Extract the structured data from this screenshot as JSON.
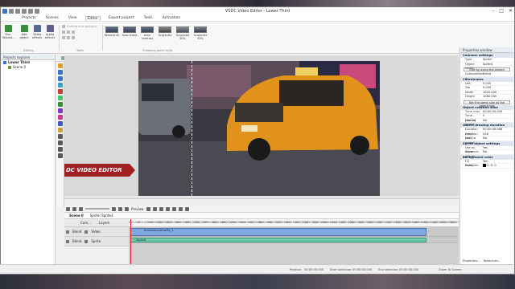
{
  "window": {
    "title": "VSDC Video Editor - Lower Third"
  },
  "menu": {
    "tabs": [
      "Projects",
      "Scenes",
      "View",
      "Editor",
      "Export project",
      "Tools",
      "Activation"
    ],
    "active": "Editor"
  },
  "ribbon": {
    "run_label": "Run Wizard...",
    "add_object_label": "Add object",
    "video_effects_label": "Video effects",
    "audio_effects_label": "Audio effects",
    "cutting_label": "Cutting and splitting",
    "editing_group": "Editing",
    "tools_group": "Tools",
    "quick_style_group": "Choosing quick style",
    "quick_styles": [
      "Remove all",
      "Auto levels",
      "Auto contrast",
      "Grayscale",
      "Grayscale 50%",
      "Grayscale 55%"
    ]
  },
  "left_panel": {
    "title": "Projects explorer",
    "items": [
      "Lower Third",
      "Scene 0"
    ],
    "bottom_tabs": [
      "Objects ex...",
      "Projects ex..."
    ]
  },
  "canvas": {
    "zoom_mode": "Zoom To Screen",
    "zoom_value": "47%",
    "lower_third_text": "DC VIDEO EDITOR"
  },
  "timeline": {
    "preview_label": "Preview",
    "tabs": [
      "Scene 0",
      "Sprite: Sprite1"
    ],
    "header_cols": [
      "Com...",
      "Layers"
    ],
    "ruler_ticks": [
      "000:000",
      "000:00.200",
      "000:00.400",
      "000:00.600",
      "000:00.800",
      "000:01.000",
      "000:01.200",
      "000:01.400",
      "000:01.600",
      "000:01.800",
      "000:02.000",
      "000:02.200",
      "000:02.400",
      "000:02.600",
      "000:02.800",
      "000:03.000",
      "000:03.200",
      "000:03.400",
      "000:03.600",
      "000:03.800",
      "000:04.000",
      "000:04.200",
      "000:04.400",
      "000:04.600",
      "000:04.800",
      "000:05.000",
      "000:05.200",
      "000:05.400",
      "000:05.600",
      "000:05.800",
      "000:06.000",
      "000:06.200",
      "000:06.400",
      "000:06.600",
      "000:06.800",
      "000:07.000"
    ],
    "tracks": [
      {
        "blend": "Blend",
        "layer": "Video",
        "clip": "timessquaretraffic_1"
      },
      {
        "blend": "Blend",
        "layer": "Sprite",
        "clip": "Sprite1"
      }
    ]
  },
  "status_bar": {
    "position_label": "Position:",
    "position_value": "00:00:00.000",
    "start_label": "Start selection:",
    "start_value": "00:00:00.000",
    "end_label": "End selection:",
    "end_value": "00:00:00.000",
    "zoom_label": "Zoom To Screen"
  },
  "properties": {
    "title": "Properties window",
    "common_section": "Common settings",
    "type_key": "Type",
    "type_val": "Sprite",
    "name_key": "Object name",
    "name_val": "Sprite1",
    "edit_btn": "Edit by using the wizard",
    "composition_key": "Composition m",
    "composition_val": "Blend",
    "coords_section": "Coordinates",
    "left_key": "Left",
    "left_val": "0.000",
    "top_key": "Top",
    "top_val": "0.000",
    "width_key": "Width",
    "width_val": "1920.000",
    "height_key": "Height",
    "height_val": "1080.000",
    "parent_btn": "Set the same size as the parent has",
    "creation_section": "Object creation time",
    "time_ms_key": "Time (ms)",
    "time_ms_val": "00:00:00.000",
    "time_frame_key": "Time (frame)",
    "time_frame_val": "0",
    "lock_parent_key": "Lock to parent",
    "lock_parent_val": "No",
    "drawing_section": "Object drawing duration",
    "dur_ms_key": "Duration (ms)",
    "dur_ms_val": "00:00:06.966",
    "dur_fr_key": "Duration (fra)",
    "dur_fr_val": "418",
    "lock_parent2_key": "Lock to parent",
    "lock_parent2_val": "No",
    "sprite_section": "Sprite object settings",
    "container_key": "Use as container",
    "container_val": "Yes",
    "show_effects_key": "Show effects",
    "show_effects_val": "No",
    "bg_section": "Background color",
    "fill_key": "Fill backgrou",
    "fill_val": "Yes",
    "color_key": "Color",
    "color_val": "0; 0; 0",
    "bottom_tabs": [
      "Properties...",
      "Resources..."
    ]
  }
}
